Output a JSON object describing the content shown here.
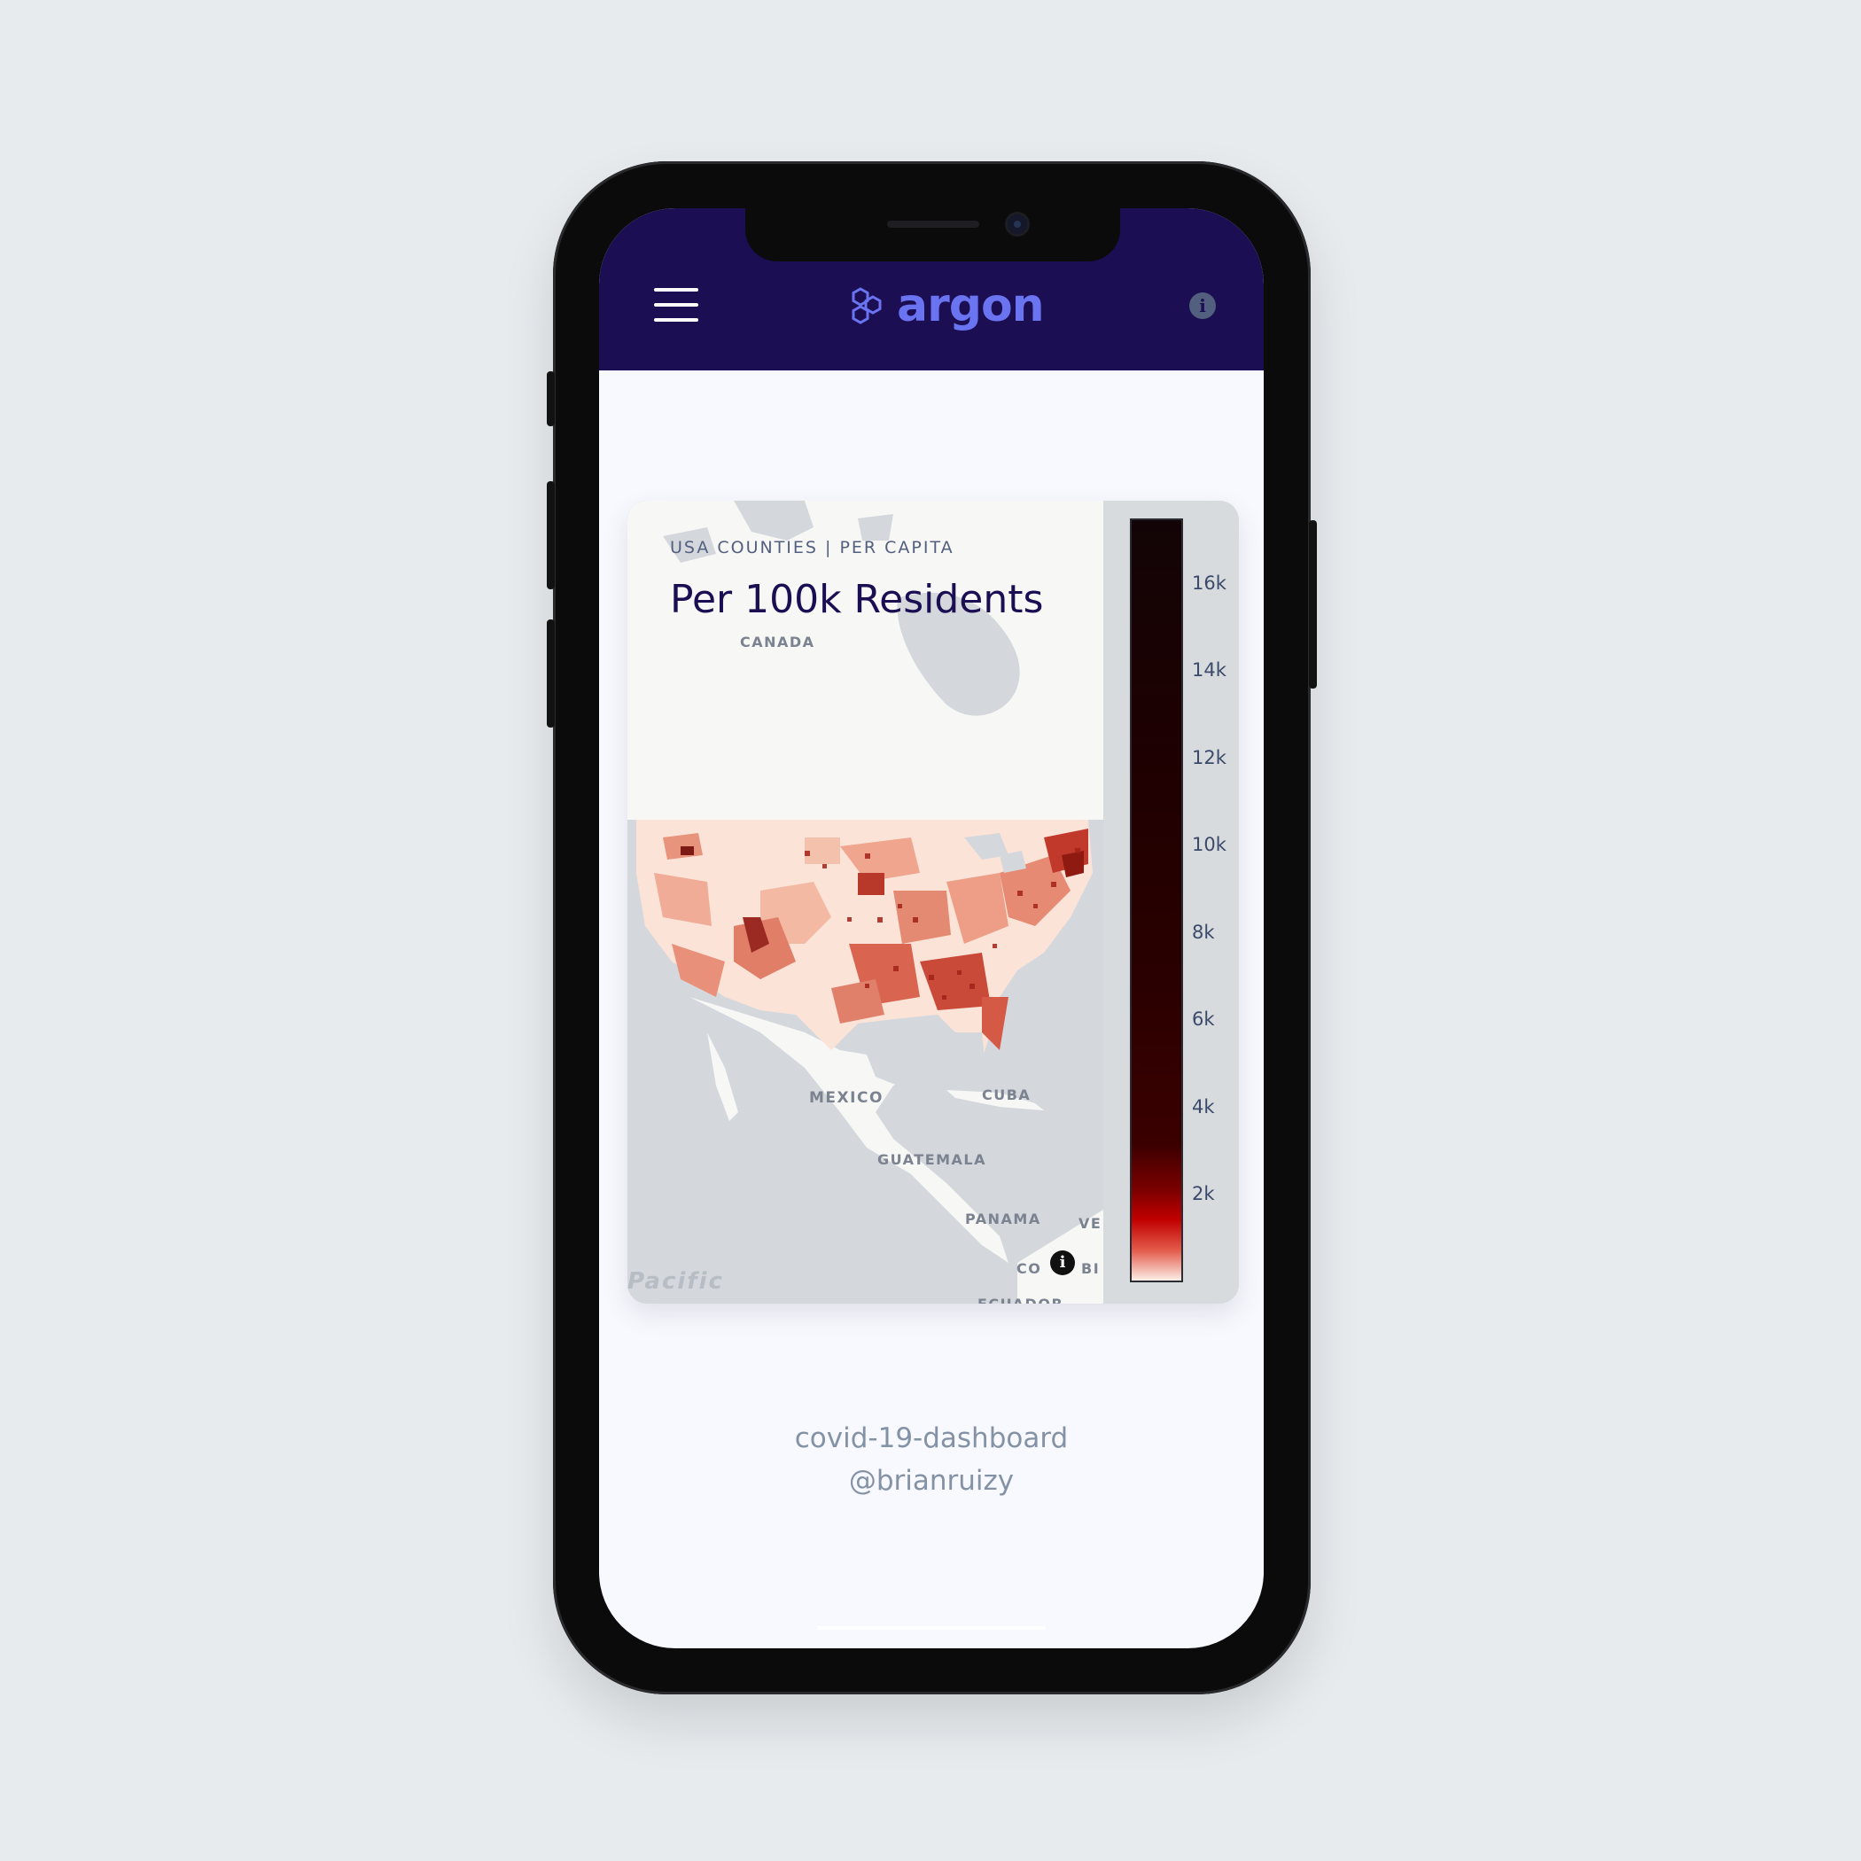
{
  "header": {
    "brand": "argon",
    "menu_icon": "hamburger-menu-icon",
    "logo_icon": "hexagons-logo-icon",
    "info_icon": "info-circle-icon",
    "info_glyph": "i"
  },
  "card": {
    "subtitle": "USA COUNTIES | PER CAPITA",
    "title": "Per 100k Residents",
    "map_labels": {
      "canada": "CANADA",
      "mexico": "MEXICO",
      "cuba": "CUBA",
      "guatemala": "GUATEMALA",
      "panama": "PANAMA",
      "venezuela": "VE",
      "colombia_left": "CO",
      "colombia_right": "BI",
      "ecuador": "ECUADOR",
      "pacific": "Pacific"
    },
    "map_info_glyph": "i",
    "colors": {
      "scale_low": "#fbeee6",
      "scale_mid": "#c10000",
      "scale_high": "#120406"
    }
  },
  "chart_data": {
    "type": "heatmap",
    "title": "Per 100k Residents",
    "colorbar": {
      "ticks": [
        "2k",
        "4k",
        "6k",
        "8k",
        "10k",
        "12k",
        "14k",
        "16k"
      ],
      "tick_values": [
        2000,
        4000,
        6000,
        8000,
        10000,
        12000,
        14000,
        16000
      ],
      "range": [
        0,
        17500
      ]
    }
  },
  "footer": {
    "line1": "covid-19-dashboard",
    "line2": "@brianruizy"
  }
}
